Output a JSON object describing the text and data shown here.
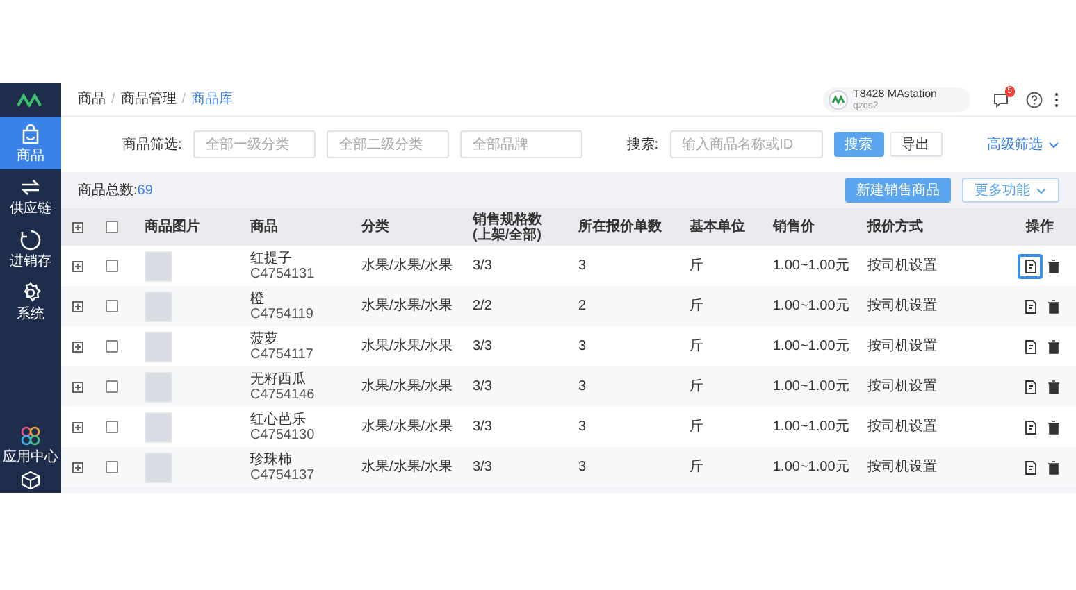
{
  "sidebar": {
    "items": [
      {
        "label": "商品",
        "selected": true,
        "kind": "bag"
      },
      {
        "label": "供应链",
        "selected": false,
        "kind": "swap"
      },
      {
        "label": "进销存",
        "selected": false,
        "kind": "cycle"
      },
      {
        "label": "系统",
        "selected": false,
        "kind": "gear"
      }
    ],
    "bottom_items": [
      {
        "label": "应用中心",
        "kind": "apps"
      }
    ]
  },
  "breadcrumb": {
    "separator": "/",
    "items": [
      "商品",
      "商品管理",
      "商品库"
    ]
  },
  "header": {
    "account_name": "T8428 MAstation",
    "account_sub": "qzcs2",
    "notification_badge": "5"
  },
  "filter": {
    "label": "商品筛选:",
    "selects": [
      {
        "placeholder": "全部一级分类"
      },
      {
        "placeholder": "全部二级分类"
      },
      {
        "placeholder": "全部品牌"
      }
    ],
    "search_label": "搜索:",
    "search": {
      "placeholder": "输入商品名称或ID"
    },
    "search_button": "搜索",
    "export_button": "导出",
    "advanced": "高级筛选"
  },
  "summary": {
    "label": "商品总数:",
    "count": "69",
    "create_button": "新建销售商品",
    "more_button": "更多功能"
  },
  "table": {
    "header_checked": false,
    "columns": [
      "商品图片",
      "商品",
      "分类",
      "销售规格数\n(上架/全部)",
      "所在报价单数",
      "基本单位",
      "销售价",
      "报价方式",
      "操作"
    ],
    "rows": [
      {
        "name": "红提子",
        "code": "C4754131",
        "category": "水果/水果/水果",
        "specs": "3/3",
        "quotes": "3",
        "unit": "斤",
        "price": "1.00~1.00元",
        "pricing": "按司机设置",
        "checked": false,
        "edit_focused": true
      },
      {
        "name": "橙",
        "code": "C4754119",
        "category": "水果/水果/水果",
        "specs": "2/2",
        "quotes": "2",
        "unit": "斤",
        "price": "1.00~1.00元",
        "pricing": "按司机设置",
        "checked": false,
        "edit_focused": false
      },
      {
        "name": "菠萝",
        "code": "C4754117",
        "category": "水果/水果/水果",
        "specs": "3/3",
        "quotes": "3",
        "unit": "斤",
        "price": "1.00~1.00元",
        "pricing": "按司机设置",
        "checked": false,
        "edit_focused": false
      },
      {
        "name": "无籽西瓜",
        "code": "C4754146",
        "category": "水果/水果/水果",
        "specs": "3/3",
        "quotes": "3",
        "unit": "斤",
        "price": "1.00~1.00元",
        "pricing": "按司机设置",
        "checked": false,
        "edit_focused": false
      },
      {
        "name": "红心芭乐",
        "code": "C4754130",
        "category": "水果/水果/水果",
        "specs": "3/3",
        "quotes": "3",
        "unit": "斤",
        "price": "1.00~1.00元",
        "pricing": "按司机设置",
        "checked": false,
        "edit_focused": false
      },
      {
        "name": "珍珠柿",
        "code": "C4754137",
        "category": "水果/水果/水果",
        "specs": "3/3",
        "quotes": "3",
        "unit": "斤",
        "price": "1.00~1.00元",
        "pricing": "按司机设置",
        "checked": false,
        "edit_focused": false
      }
    ]
  }
}
